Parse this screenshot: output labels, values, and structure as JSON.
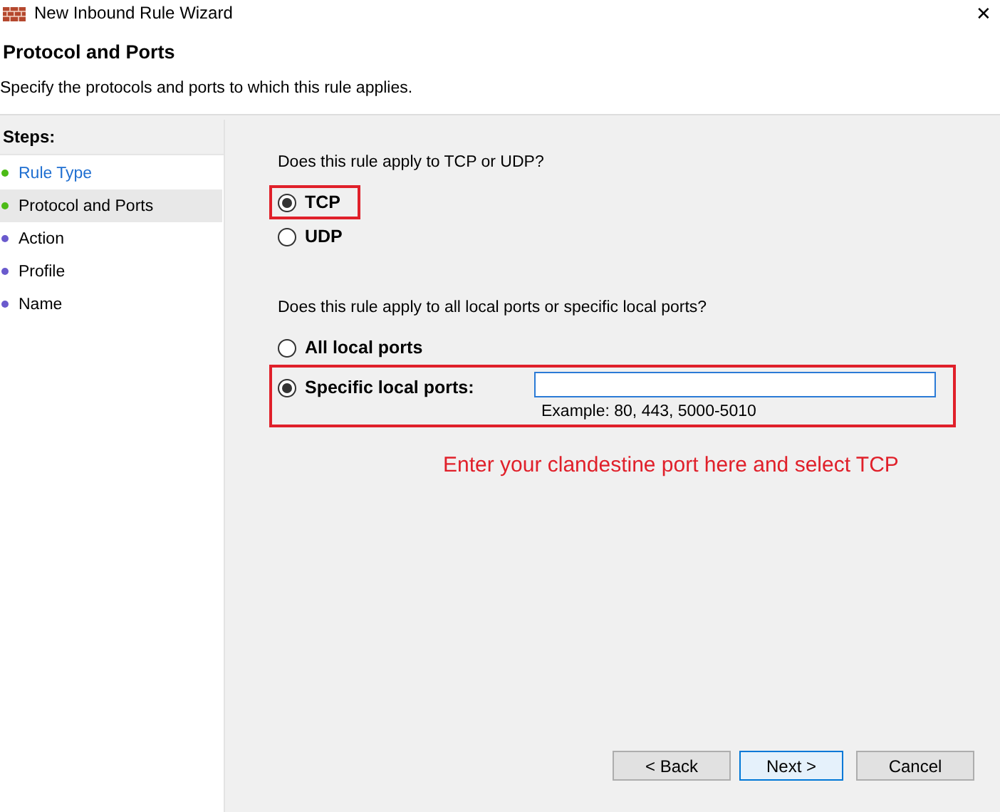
{
  "window": {
    "title": "New Inbound Rule Wizard",
    "close": "✕"
  },
  "header": {
    "title": "Protocol and Ports",
    "subtitle": "Specify the protocols and ports to which this rule applies."
  },
  "steps": {
    "title": "Steps:",
    "items": [
      {
        "label": "Rule Type",
        "color": "#4cbb17",
        "selected": false,
        "link": true
      },
      {
        "label": "Protocol and Ports",
        "color": "#4cbb17",
        "selected": true,
        "link": false
      },
      {
        "label": "Action",
        "color": "#6a5acd",
        "selected": false,
        "link": false
      },
      {
        "label": "Profile",
        "color": "#6a5acd",
        "selected": false,
        "link": false
      },
      {
        "label": "Name",
        "color": "#6a5acd",
        "selected": false,
        "link": false
      }
    ]
  },
  "protocol": {
    "question": "Does this rule apply to TCP or UDP?",
    "options": [
      {
        "label": "TCP",
        "selected": true,
        "kind": "framed"
      },
      {
        "label": "UDP",
        "selected": false,
        "kind": "plain"
      }
    ]
  },
  "ports": {
    "question": "Does this rule apply to all local ports or specific local ports?",
    "options": [
      {
        "label": "All local ports",
        "selected": false,
        "kind": "plain"
      },
      {
        "label": "Specific local ports:",
        "selected": true,
        "kind": "framed",
        "field": {
          "example": "Example: 80, 443, 5000-5010"
        }
      }
    ]
  },
  "annotation": "Enter your clandestine port here and select TCP",
  "buttons": [
    {
      "label": "< Back",
      "default": false
    },
    {
      "label": "Next >",
      "default": true
    },
    {
      "label": "Cancel",
      "default": false
    }
  ]
}
